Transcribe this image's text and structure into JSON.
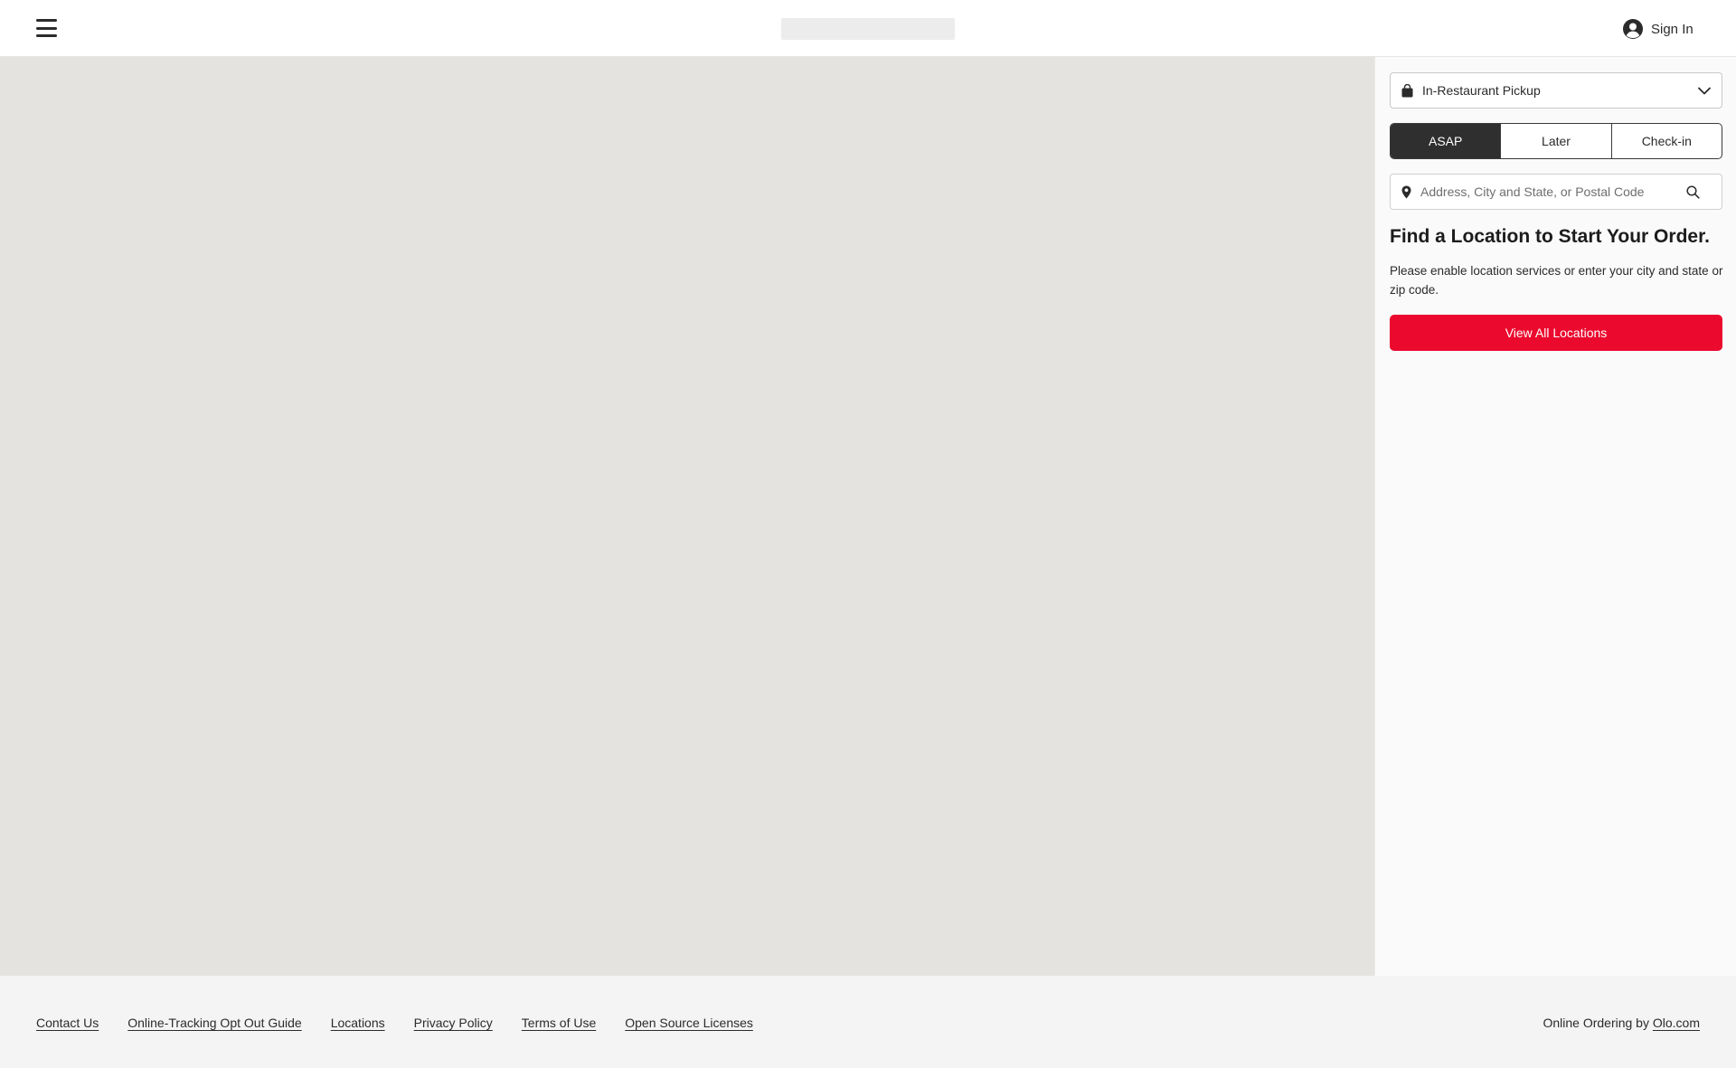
{
  "header": {
    "menu_icon": "hamburger-menu-icon",
    "signin_icon": "user-circle-icon",
    "signin_label": "Sign In"
  },
  "panel": {
    "mode_select": {
      "icon": "shopping-bag-icon",
      "value": "In-Restaurant Pickup",
      "chevron_icon": "chevron-down-icon"
    },
    "time_options": [
      {
        "label": "ASAP",
        "active": true
      },
      {
        "label": "Later",
        "active": false
      },
      {
        "label": "Check-in",
        "active": false
      }
    ],
    "search": {
      "placeholder": "Address, City and State, or Postal Code",
      "value": "",
      "pin_icon": "map-pin-icon",
      "search_icon": "search-icon"
    },
    "heading": "Find a Location to Start Your Order.",
    "description": "Please enable location services or enter your city and state or zip code.",
    "view_all_label": "View All Locations"
  },
  "footer": {
    "links": [
      "Contact Us",
      "Online-Tracking Opt Out Guide",
      "Locations",
      "Privacy Policy",
      "Terms of Use",
      "Open Source Licenses"
    ],
    "credit_prefix": "Online Ordering by ",
    "credit_link": "Olo.com"
  },
  "colors": {
    "accent": "#eb0a2e",
    "segment_active": "#2f2f2f",
    "map_background": "#e5e3df",
    "footer_background": "#f4f4f4"
  }
}
